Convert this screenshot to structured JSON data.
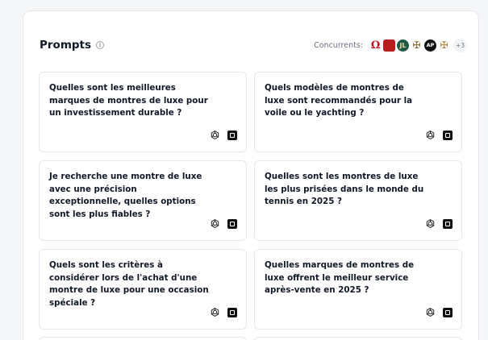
{
  "header": {
    "title": "Prompts",
    "info_icon": "info-icon",
    "competitors_label": "Concurrents:",
    "competitors": [
      {
        "name": "omega-logo",
        "glyph": "Ω"
      },
      {
        "name": "cartier-logo",
        "glyph": ""
      },
      {
        "name": "jaeger-lecoultre-logo",
        "glyph": "JL"
      },
      {
        "name": "vacheron-constantin-logo",
        "glyph": "✠"
      },
      {
        "name": "audemars-piguet-logo",
        "glyph": "AP"
      },
      {
        "name": "patek-philippe-logo",
        "glyph": "✠"
      }
    ],
    "more_count": "+3"
  },
  "prompts": [
    {
      "text": "Quelles sont les meilleures marques de montres de luxe pour un investissement durable ?"
    },
    {
      "text": "Quels modèles de montres de luxe sont recommandés pour la voile ou le yachting ?"
    },
    {
      "text": "Je recherche une montre de luxe avec une précision exceptionnelle, quelles options sont les plus fiables ?"
    },
    {
      "text": "Quelles sont les montres de luxe les plus prisées dans le monde du tennis en 2025 ?"
    },
    {
      "text": "Quels sont les critères à considérer lors de l'achat d'une montre de luxe pour une occasion spéciale ?"
    },
    {
      "text": "Quelles marques de montres de luxe offrent le meilleur service après-vente en 2025 ?"
    }
  ],
  "colors": {
    "accent": "#111827",
    "border": "#e5e7eb",
    "muted": "#6b7280"
  }
}
